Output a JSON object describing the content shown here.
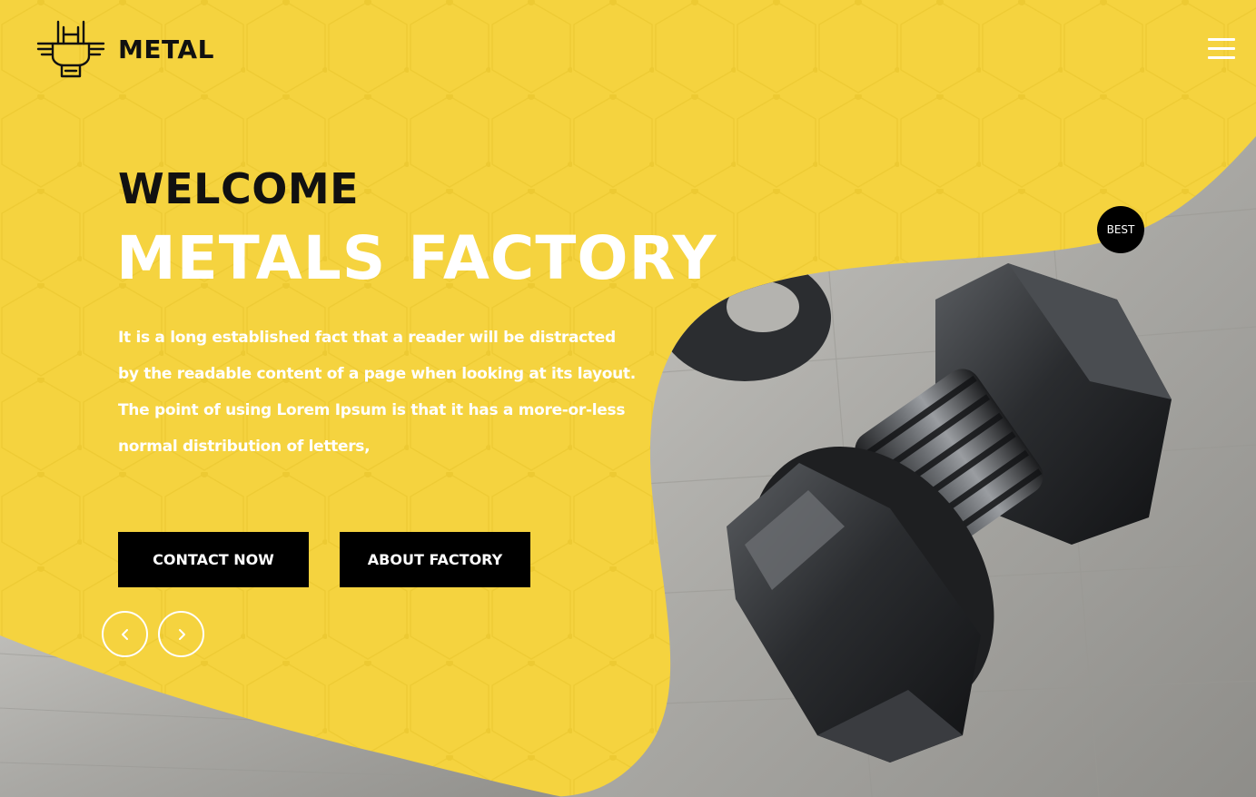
{
  "brand": {
    "name": "METAL",
    "logo_icon": "rock-hand-icon"
  },
  "nav": {
    "menu_icon": "hamburger-menu-icon"
  },
  "hero": {
    "welcome": "WELCOME",
    "headline": "METALS FACTORY",
    "description": "It is a long established fact that a reader will be distracted by the readable content of a page when looking at its layout. The point of using Lorem Ipsum is that it has a more-or-less normal distribution of letters,",
    "buttons": {
      "contact_label": "CONTACT NOW",
      "about_label": "ABOUT FACTORY"
    },
    "slider": {
      "prev_icon": "chevron-left-icon",
      "next_icon": "chevron-right-icon"
    },
    "badge": "BEST",
    "image": "bolt-and-nut-photo"
  },
  "colors": {
    "accent_yellow": "#f5d33f",
    "button_black": "#000000",
    "text_white": "#ffffff",
    "text_dark": "#111111"
  }
}
